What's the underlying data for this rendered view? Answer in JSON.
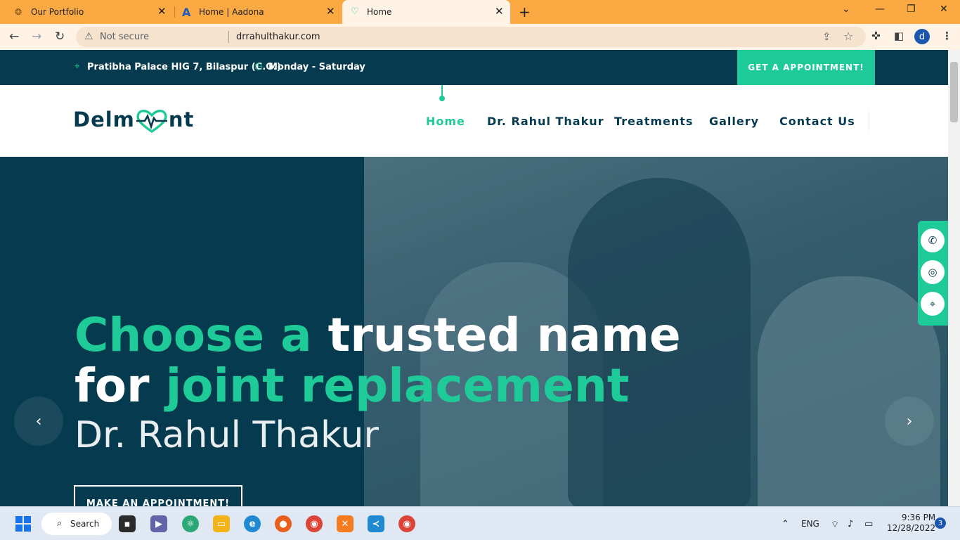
{
  "browser": {
    "tabs": [
      {
        "label": "Our Portfolio",
        "icon": "portfolio-favicon"
      },
      {
        "label": "Home | Aadona",
        "icon": "aadona-favicon"
      },
      {
        "label": "Home",
        "icon": "heart-favicon"
      }
    ],
    "not_secure": "Not secure",
    "url": "drrahulthakur.com",
    "profile_initial": "d"
  },
  "site": {
    "address": "Pratibha Palace HIG 7, Bilaspur (C.G.)",
    "hours": "Monday - Saturday",
    "top_cta": "GET A APPOINTMENT!",
    "logo_left": "Delm",
    "logo_right": "nt",
    "nav": [
      "Home",
      "Dr. Rahul Thakur",
      "Treatments",
      "Gallery",
      "Contact Us"
    ],
    "hero": {
      "line1_green": "Choose a",
      "line1_white": "trusted name",
      "line2_white": "for",
      "line2_green": "joint replacement",
      "subtitle": "Dr. Rahul Thakur",
      "button": "MAKE AN APPOINTMENT!"
    },
    "social": [
      "phone-icon",
      "instagram-icon",
      "location-pin-icon"
    ]
  },
  "taskbar": {
    "search_label": "Search",
    "lang": "ENG",
    "time": "9:36 PM",
    "date": "12/28/2022",
    "notification_count": "3"
  },
  "colors": {
    "brand_dark": "#063a4e",
    "brand_green": "#1ecb98",
    "chrome_tabbar": "#fba943"
  }
}
